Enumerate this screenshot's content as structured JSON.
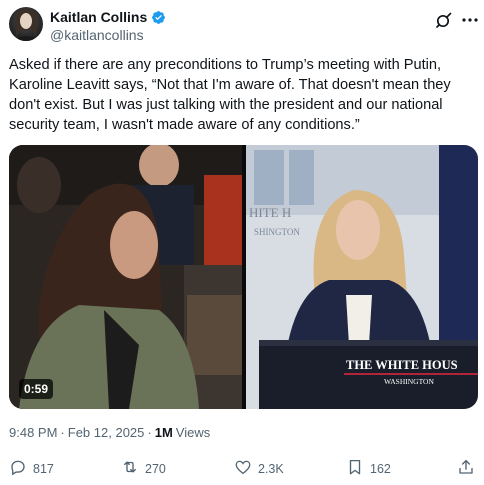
{
  "author": {
    "name": "Kaitlan Collins",
    "handle": "@kaitlancollins",
    "verified": true
  },
  "tweet": {
    "text": "Asked if there are any preconditions to Trump’s meeting with Putin, Karoline Leavitt says, “Not that I'm aware of. That doesn't mean they don't exist. But I was just talking with the president and our national security team, I wasn't made aware of any conditions.”"
  },
  "media": {
    "duration": "0:59",
    "podium_text_line1": "THE WHITE HOUS",
    "podium_text_line2": "WASHINGTON",
    "backdrop_text_line1": "HITE H",
    "backdrop_text_line2": "SHINGTON"
  },
  "meta": {
    "time": "9:48 PM",
    "separator1": "·",
    "date": "Feb 12, 2025",
    "separator2": "·",
    "views_count": "1M",
    "views_label": "Views"
  },
  "actions": {
    "replies": "817",
    "reposts": "270",
    "likes": "2.3K",
    "bookmarks": "162"
  },
  "colors": {
    "text_primary": "#0f1419",
    "text_secondary": "#536471",
    "verified_blue": "#1d9bf0"
  }
}
